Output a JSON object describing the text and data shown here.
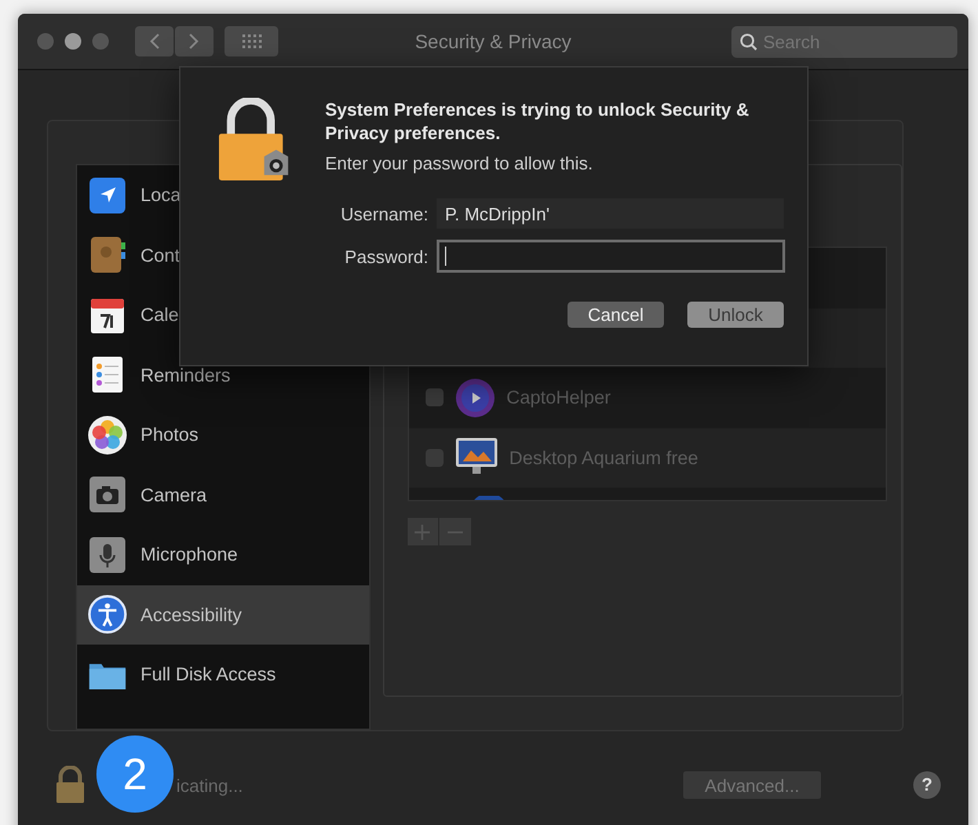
{
  "window": {
    "title": "Security & Privacy",
    "search": {
      "placeholder": "Search"
    }
  },
  "sidebar": {
    "items": [
      {
        "label": "Loca",
        "selected": false
      },
      {
        "label": "Cont",
        "selected": false
      },
      {
        "label": "Cale",
        "selected": false
      },
      {
        "label": "Reminders",
        "selected": false
      },
      {
        "label": "Photos",
        "selected": false
      },
      {
        "label": "Camera",
        "selected": false
      },
      {
        "label": "Microphone",
        "selected": false
      },
      {
        "label": "Accessibility",
        "selected": true
      },
      {
        "label": "Full Disk Access",
        "selected": false
      }
    ]
  },
  "app_list": {
    "rows": [
      {
        "label": "CaptoHelper",
        "checked": false
      },
      {
        "label": "Desktop Aquarium free",
        "checked": false
      }
    ]
  },
  "footer": {
    "status": "icating...",
    "advanced_button": "Advanced...",
    "help_button": "?"
  },
  "dialog": {
    "heading": "System Preferences is trying to unlock Security & Privacy preferences.",
    "message": "Enter your password to allow this.",
    "username": {
      "label": "Username:",
      "value": "P. McDrippIn'"
    },
    "password": {
      "label": "Password:",
      "focused": true
    },
    "buttons": [
      {
        "label": "Cancel",
        "default": false
      },
      {
        "label": "Unlock",
        "default": true
      }
    ]
  },
  "badge": {
    "text": "2"
  }
}
